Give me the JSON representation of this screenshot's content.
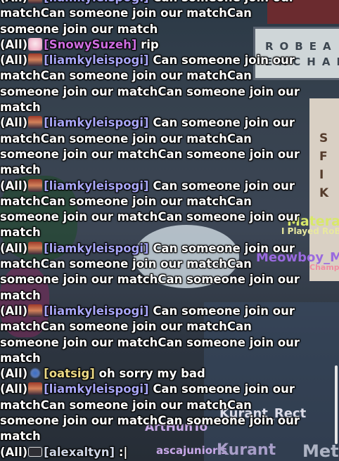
{
  "chat": {
    "messages": [
      {
        "channel": "(All)",
        "avatar": "roblox-avatar-icon",
        "name": "[liamkyleispogi]",
        "name_color": "#a8a6f6",
        "text": "Can someone join our matchCan someone join our matchCan someone join our match"
      },
      {
        "channel": "(All)",
        "avatar": "roblox-avatar-icon",
        "name": "[SnowySuzeh]",
        "name_color": "#ce6de0",
        "text": "rip"
      },
      {
        "channel": "(All)",
        "avatar": "roblox-avatar-icon",
        "name": "[liamkyleispogi]",
        "name_color": "#a8a6f6",
        "text": "Can someone join our matchCan someone join our matchCan someone join our matchCan someone join our match"
      },
      {
        "channel": "(All)",
        "avatar": "roblox-avatar-icon",
        "name": "[liamkyleispogi]",
        "name_color": "#a8a6f6",
        "text": "Can someone join our matchCan someone join our matchCan someone join our matchCan someone join our match"
      },
      {
        "channel": "(All)",
        "avatar": "roblox-avatar-icon",
        "name": "[liamkyleispogi]",
        "name_color": "#a8a6f6",
        "text": "Can someone join our matchCan someone join our matchCan someone join our matchCan someone join our match"
      },
      {
        "channel": "(All)",
        "avatar": "roblox-avatar-icon",
        "name": "[liamkyleispogi]",
        "name_color": "#a8a6f6",
        "text": "Can someone join our matchCan someone join our matchCan someone join our matchCan someone join our match"
      },
      {
        "channel": "(All)",
        "avatar": "roblox-avatar-icon",
        "name": "[liamkyleispogi]",
        "name_color": "#a8a6f6",
        "text": "Can someone join our matchCan someone join our matchCan someone join our matchCan someone join our match"
      },
      {
        "channel": "(All)",
        "avatar": "roblox-avatar-icon",
        "name": "[oatsig]",
        "name_color": "#ead884",
        "text": "oh sorry my bad"
      },
      {
        "channel": "(All)",
        "avatar": "roblox-avatar-icon",
        "name": "[liamkyleispogi]",
        "name_color": "#a8a6f6",
        "text": "Can someone join our matchCan someone join our matchCan someone join our matchCan someone join our match"
      },
      {
        "channel": "(All)",
        "avatar": "roblox-avatar-icon",
        "name": "[alexaltyn]",
        "name_color": "#cfd6e6",
        "text": ":|"
      }
    ]
  },
  "scene": {
    "sign": {
      "line1": "ROBEA",
      "line2": "EXCHAN"
    },
    "post_letters": [
      "S",
      "F",
      "I",
      "K"
    ],
    "player_tags": [
      {
        "name": "Matera",
        "sub": "I Played RoBe"
      },
      {
        "name": "Meowboy_M",
        "sub": "Champion"
      },
      {
        "name": "Kurant_Rect"
      },
      {
        "name": "ArtHunTo"
      },
      {
        "name": "ascajunior's"
      },
      {
        "name": "Kurant"
      },
      {
        "name": "Met"
      }
    ]
  }
}
